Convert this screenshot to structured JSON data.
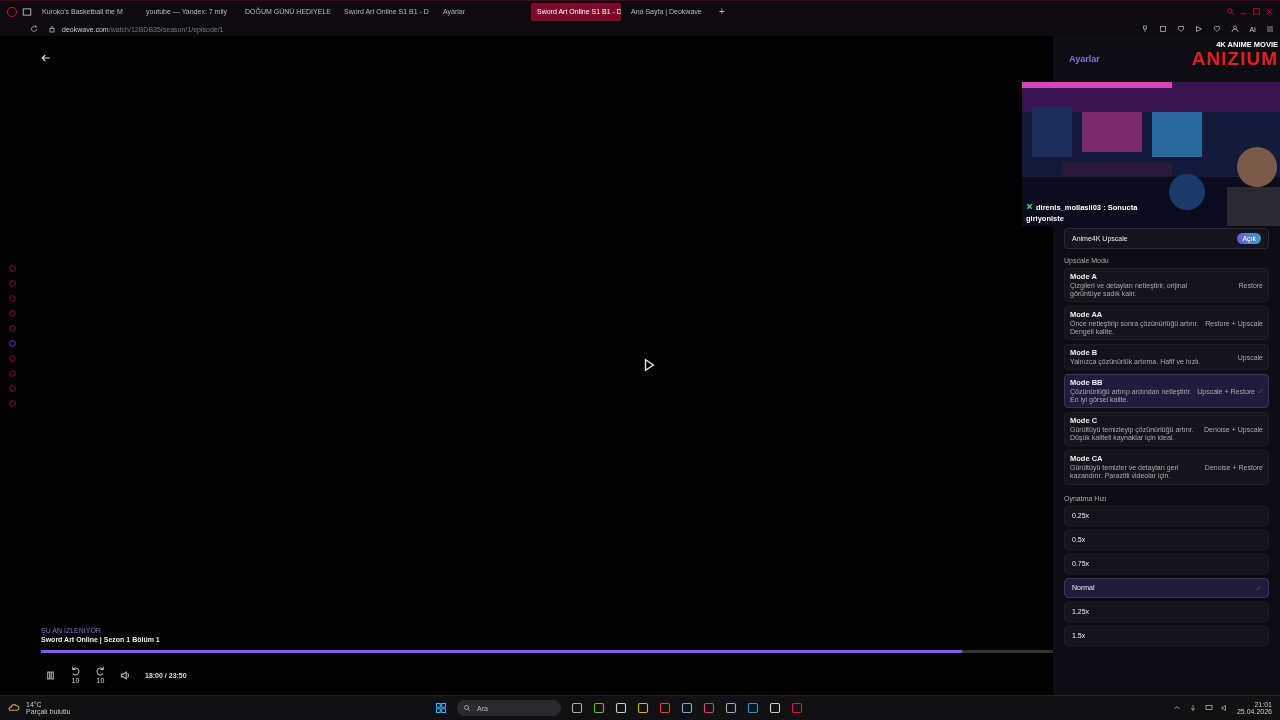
{
  "browser": {
    "tabs": [
      {
        "label": "Kuroko's Basketball the M",
        "selected": false
      },
      {
        "label": "youtube — Yandex: 7 mily",
        "selected": false
      },
      {
        "label": "DOĞUM GÜNÜ HEDIYELE",
        "selected": false
      },
      {
        "label": "Sword Art Online S1 B1 - D",
        "selected": false
      },
      {
        "label": "Ayarlar",
        "selected": false
      },
      {
        "label": "Sword Art Online S1 B1 - D",
        "selected": true
      },
      {
        "label": "Ana Sayfa | Deokwave",
        "selected": false
      }
    ],
    "new_tab": "+",
    "url_domain": "deokwave.com",
    "url_path": "/watch/12BDB35/season/1/episode/1",
    "ai_label": "AI"
  },
  "player": {
    "now_watching_label": "ŞU AN İZLENİYOR",
    "title": "Sword Art Online | Sezon 1 Bölüm 1",
    "level": 0.91,
    "rewind_label": "10",
    "forward_label": "10",
    "time": "18:00 / 23:50"
  },
  "overlay": {
    "logo_top": "4K ANIME MOVIE",
    "logo_name": "ANIZIUM",
    "chat_user": "direnis_mollasii03",
    "chat_message": ": Sonucta giriyoniste"
  },
  "settings": {
    "title": "Ayarlar",
    "upscale": {
      "label": "Anime4K Upscale",
      "on": true,
      "state_label": "Açık"
    },
    "modes_heading": "Upscale Modu",
    "modes": [
      {
        "name": "Mode A",
        "description": "Çizgileri ve detayları netleştirir, orijinal görüntüye sadık kalır.",
        "tag": "Restore",
        "selected": false
      },
      {
        "name": "Mode AA",
        "description": "Önce netleştirip sonra çözünürlüğü artırır. Dengeli kalite.",
        "tag": "Restore + Upscale",
        "selected": false
      },
      {
        "name": "Mode B",
        "description": "Yalnızca çözünürlük artırma. Hafif ve hızlı.",
        "tag": "Upscale",
        "selected": false
      },
      {
        "name": "Mode BB",
        "description": "Çözünürlüğü artırıp ardından netleştirir. En iyi görsel kalite.",
        "tag": "Upscale + Restore",
        "selected": true
      },
      {
        "name": "Mode C",
        "description": "Gürültüyü temizleyip çözünürlüğü artırır. Düşük kaliteli kaynaklar için ideal.",
        "tag": "Denoise + Upscale",
        "selected": false
      },
      {
        "name": "Mode CA",
        "description": "Gürültüyü temizler ve detayları geri kazandırır. Parazitli videolar için.",
        "tag": "Denoise + Restore",
        "selected": false
      }
    ],
    "speed_heading": "Oynatma Hızı",
    "speeds": [
      {
        "label": "0.25x",
        "selected": false
      },
      {
        "label": "0.5x",
        "selected": false
      },
      {
        "label": "0.75x",
        "selected": false
      },
      {
        "label": "Normal",
        "selected": true
      },
      {
        "label": "1.25x",
        "selected": false
      },
      {
        "label": "1.5x",
        "selected": false
      }
    ]
  },
  "taskbar": {
    "weather_temp": "14°C",
    "weather_text": "Parçalı bulutlu",
    "search_placeholder": "Ara",
    "time": "21:01",
    "date": "25.04.2026"
  }
}
